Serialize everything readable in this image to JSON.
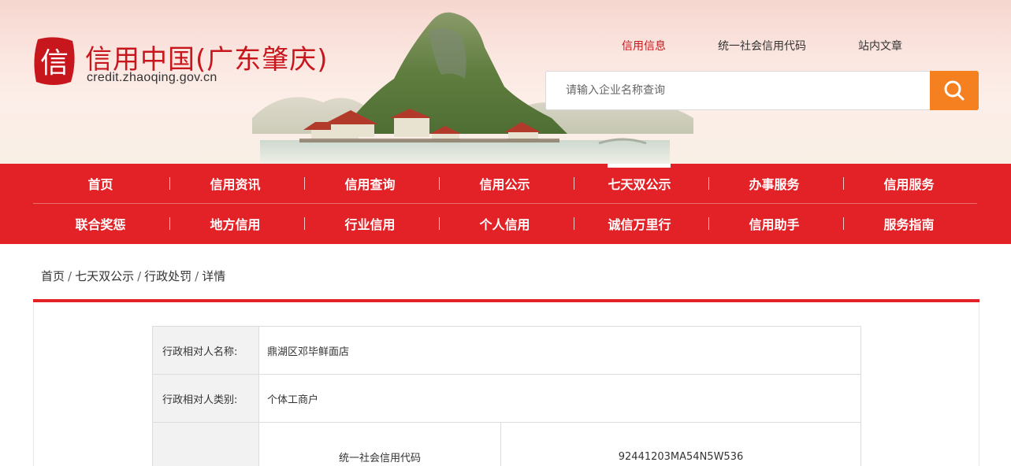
{
  "site": {
    "title": "信用中国(广东肇庆)",
    "url": "credit.zhaoqing.gov.cn",
    "logo_char": "信"
  },
  "top_links": [
    {
      "label": "信用信息",
      "active": true
    },
    {
      "label": "统一社会信用代码",
      "active": false
    },
    {
      "label": "站内文章",
      "active": false
    }
  ],
  "search": {
    "placeholder": "请输入企业名称查询",
    "icon": "search-icon"
  },
  "nav": {
    "row1": [
      "首页",
      "信用资讯",
      "信用查询",
      "信用公示",
      "七天双公示",
      "办事服务",
      "信用服务"
    ],
    "row2": [
      "联合奖惩",
      "地方信用",
      "行业信用",
      "个人信用",
      "诚信万里行",
      "信用助手",
      "服务指南"
    ],
    "active": "七天双公示",
    "separator": "|"
  },
  "breadcrumb": {
    "items": [
      "首页",
      "七天双公示",
      "行政处罚",
      "详情"
    ],
    "separator": "/"
  },
  "detail": {
    "name_label": "行政相对人名称:",
    "name_value": "鼎湖区邓毕鲜面店",
    "type_label": "行政相对人类别:",
    "type_value": "个体工商户",
    "code_label": "统一社会信用代码",
    "code_value": "92441203MA54N5W536"
  },
  "colors": {
    "brand_red": "#e22227",
    "title_red": "#c8161d",
    "search_orange": "#f4801f"
  }
}
